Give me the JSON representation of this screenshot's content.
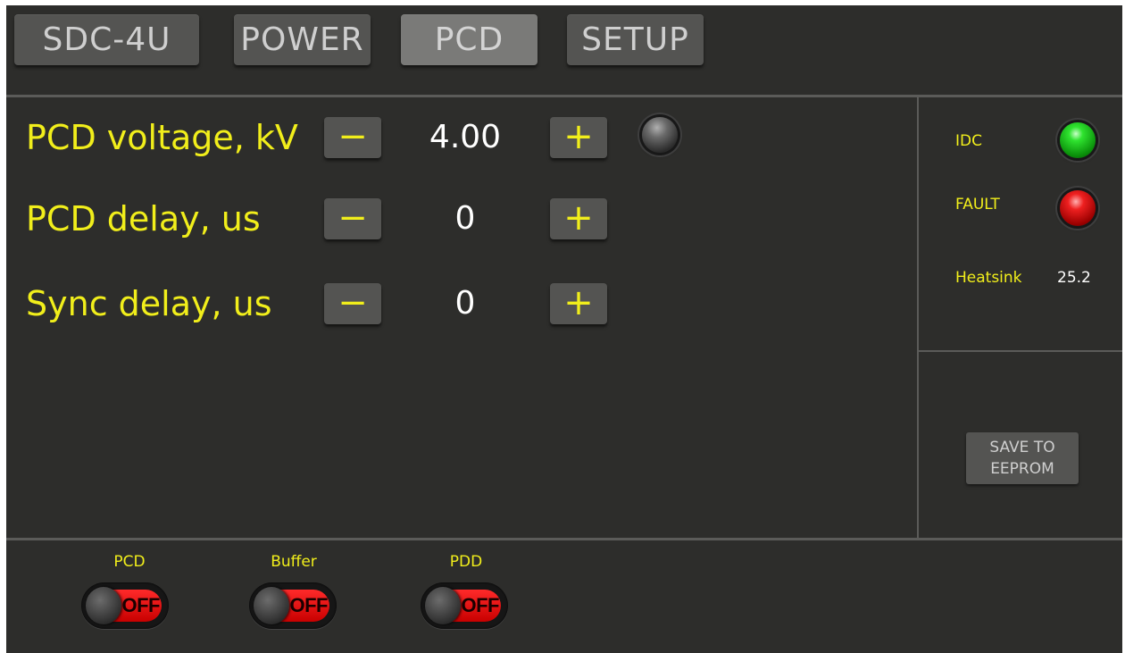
{
  "tabs": [
    {
      "label": "SDC-4U",
      "active": false
    },
    {
      "label": "POWER",
      "active": false
    },
    {
      "label": "PCD",
      "active": true
    },
    {
      "label": "SETUP",
      "active": false
    }
  ],
  "params": [
    {
      "label": "PCD voltage, kV",
      "value": "4.00",
      "minus": "−",
      "plus": "+"
    },
    {
      "label": "PCD delay, us",
      "value": "0",
      "minus": "−",
      "plus": "+"
    },
    {
      "label": "Sync delay, us",
      "value": "0",
      "minus": "−",
      "plus": "+"
    }
  ],
  "indicators": {
    "voltage_led": "gray-icon",
    "idc": {
      "label": "IDC",
      "color": "#2fe32f"
    },
    "fault": {
      "label": "FAULT",
      "color": "#ee2020"
    },
    "heatsink": {
      "label": "Heatsink",
      "value": "25.2"
    }
  },
  "save": {
    "line1": "SAVE TO",
    "line2": "EEPROM"
  },
  "toggles": [
    {
      "label": "PCD",
      "state": "OFF"
    },
    {
      "label": "Buffer",
      "state": "OFF"
    },
    {
      "label": "PDD",
      "state": "OFF"
    }
  ],
  "colors": {
    "background": "#2d2d2b",
    "label_yellow": "#f1ee1b",
    "toggle_off": "#ff2a2a"
  }
}
